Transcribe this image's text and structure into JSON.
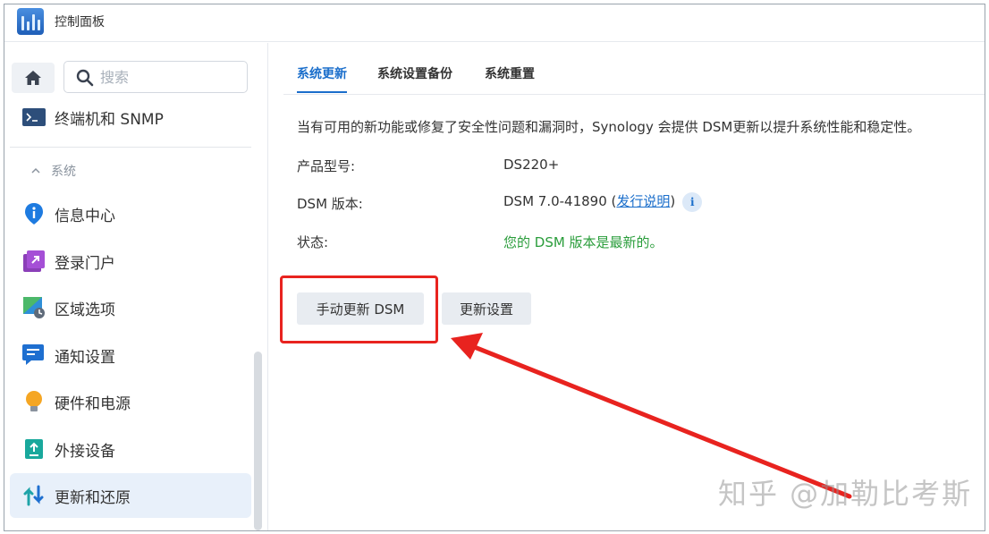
{
  "window": {
    "title": "控制面板"
  },
  "sidebar": {
    "search_placeholder": "搜索",
    "top_item": "终端机和 SNMP",
    "section_header": "系统",
    "items": [
      {
        "label": "信息中心",
        "icon": "info-pin-icon"
      },
      {
        "label": "登录门户",
        "icon": "login-portal-icon"
      },
      {
        "label": "区域选项",
        "icon": "region-map-icon"
      },
      {
        "label": "通知设置",
        "icon": "notification-icon"
      },
      {
        "label": "硬件和电源",
        "icon": "bulb-icon"
      },
      {
        "label": "外接设备",
        "icon": "external-device-icon"
      },
      {
        "label": "更新和还原",
        "icon": "update-restore-icon",
        "active": true
      }
    ]
  },
  "tabs": [
    {
      "label": "系统更新",
      "active": true
    },
    {
      "label": "系统设置备份"
    },
    {
      "label": "系统重置"
    }
  ],
  "content": {
    "description": "当有可用的新功能或修复了安全性问题和漏洞时，Synology 会提供 DSM更新以提升系统性能和稳定性。",
    "rows": [
      {
        "label": "产品型号:",
        "value": "DS220+"
      },
      {
        "label": "DSM 版本:",
        "value_prefix": "DSM 7.0-41890 (",
        "link": "发行说明",
        "value_suffix": ")"
      },
      {
        "label": "状态:",
        "value": "您的 DSM 版本是最新的。"
      }
    ],
    "buttons": {
      "manual_update": "手动更新 DSM",
      "update_settings": "更新设置"
    }
  },
  "overlay": {
    "watermark": "知乎 @加勒比考斯",
    "highlight_color": "#e8231f"
  }
}
